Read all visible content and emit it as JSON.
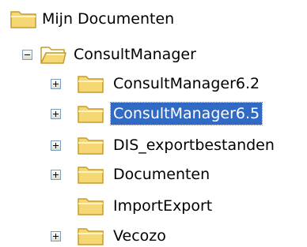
{
  "tree": {
    "root": {
      "label": "Mijn Documenten",
      "icon": "folder-icon"
    },
    "parent": {
      "label": "ConsultManager",
      "expanded": true,
      "icon": "open-folder-icon"
    },
    "children": [
      {
        "label": "ConsultManager6.2",
        "expander": "plus",
        "selected": false,
        "icon": "folder-icon"
      },
      {
        "label": "ConsultManager6.5",
        "expander": "plus",
        "selected": true,
        "icon": "folder-icon"
      },
      {
        "label": "DIS_exportbestanden",
        "expander": "plus",
        "selected": false,
        "icon": "folder-icon"
      },
      {
        "label": "Documenten",
        "expander": "plus",
        "selected": false,
        "icon": "folder-icon"
      },
      {
        "label": "ImportExport",
        "expander": "none",
        "selected": false,
        "icon": "folder-icon"
      },
      {
        "label": "Vecozo",
        "expander": "plus",
        "selected": false,
        "icon": "folder-icon"
      }
    ]
  },
  "colors": {
    "selection_bg": "#316ac5",
    "selection_text": "#ffffff",
    "folder_fill": "#f5d773",
    "folder_edge": "#c79b2d"
  }
}
